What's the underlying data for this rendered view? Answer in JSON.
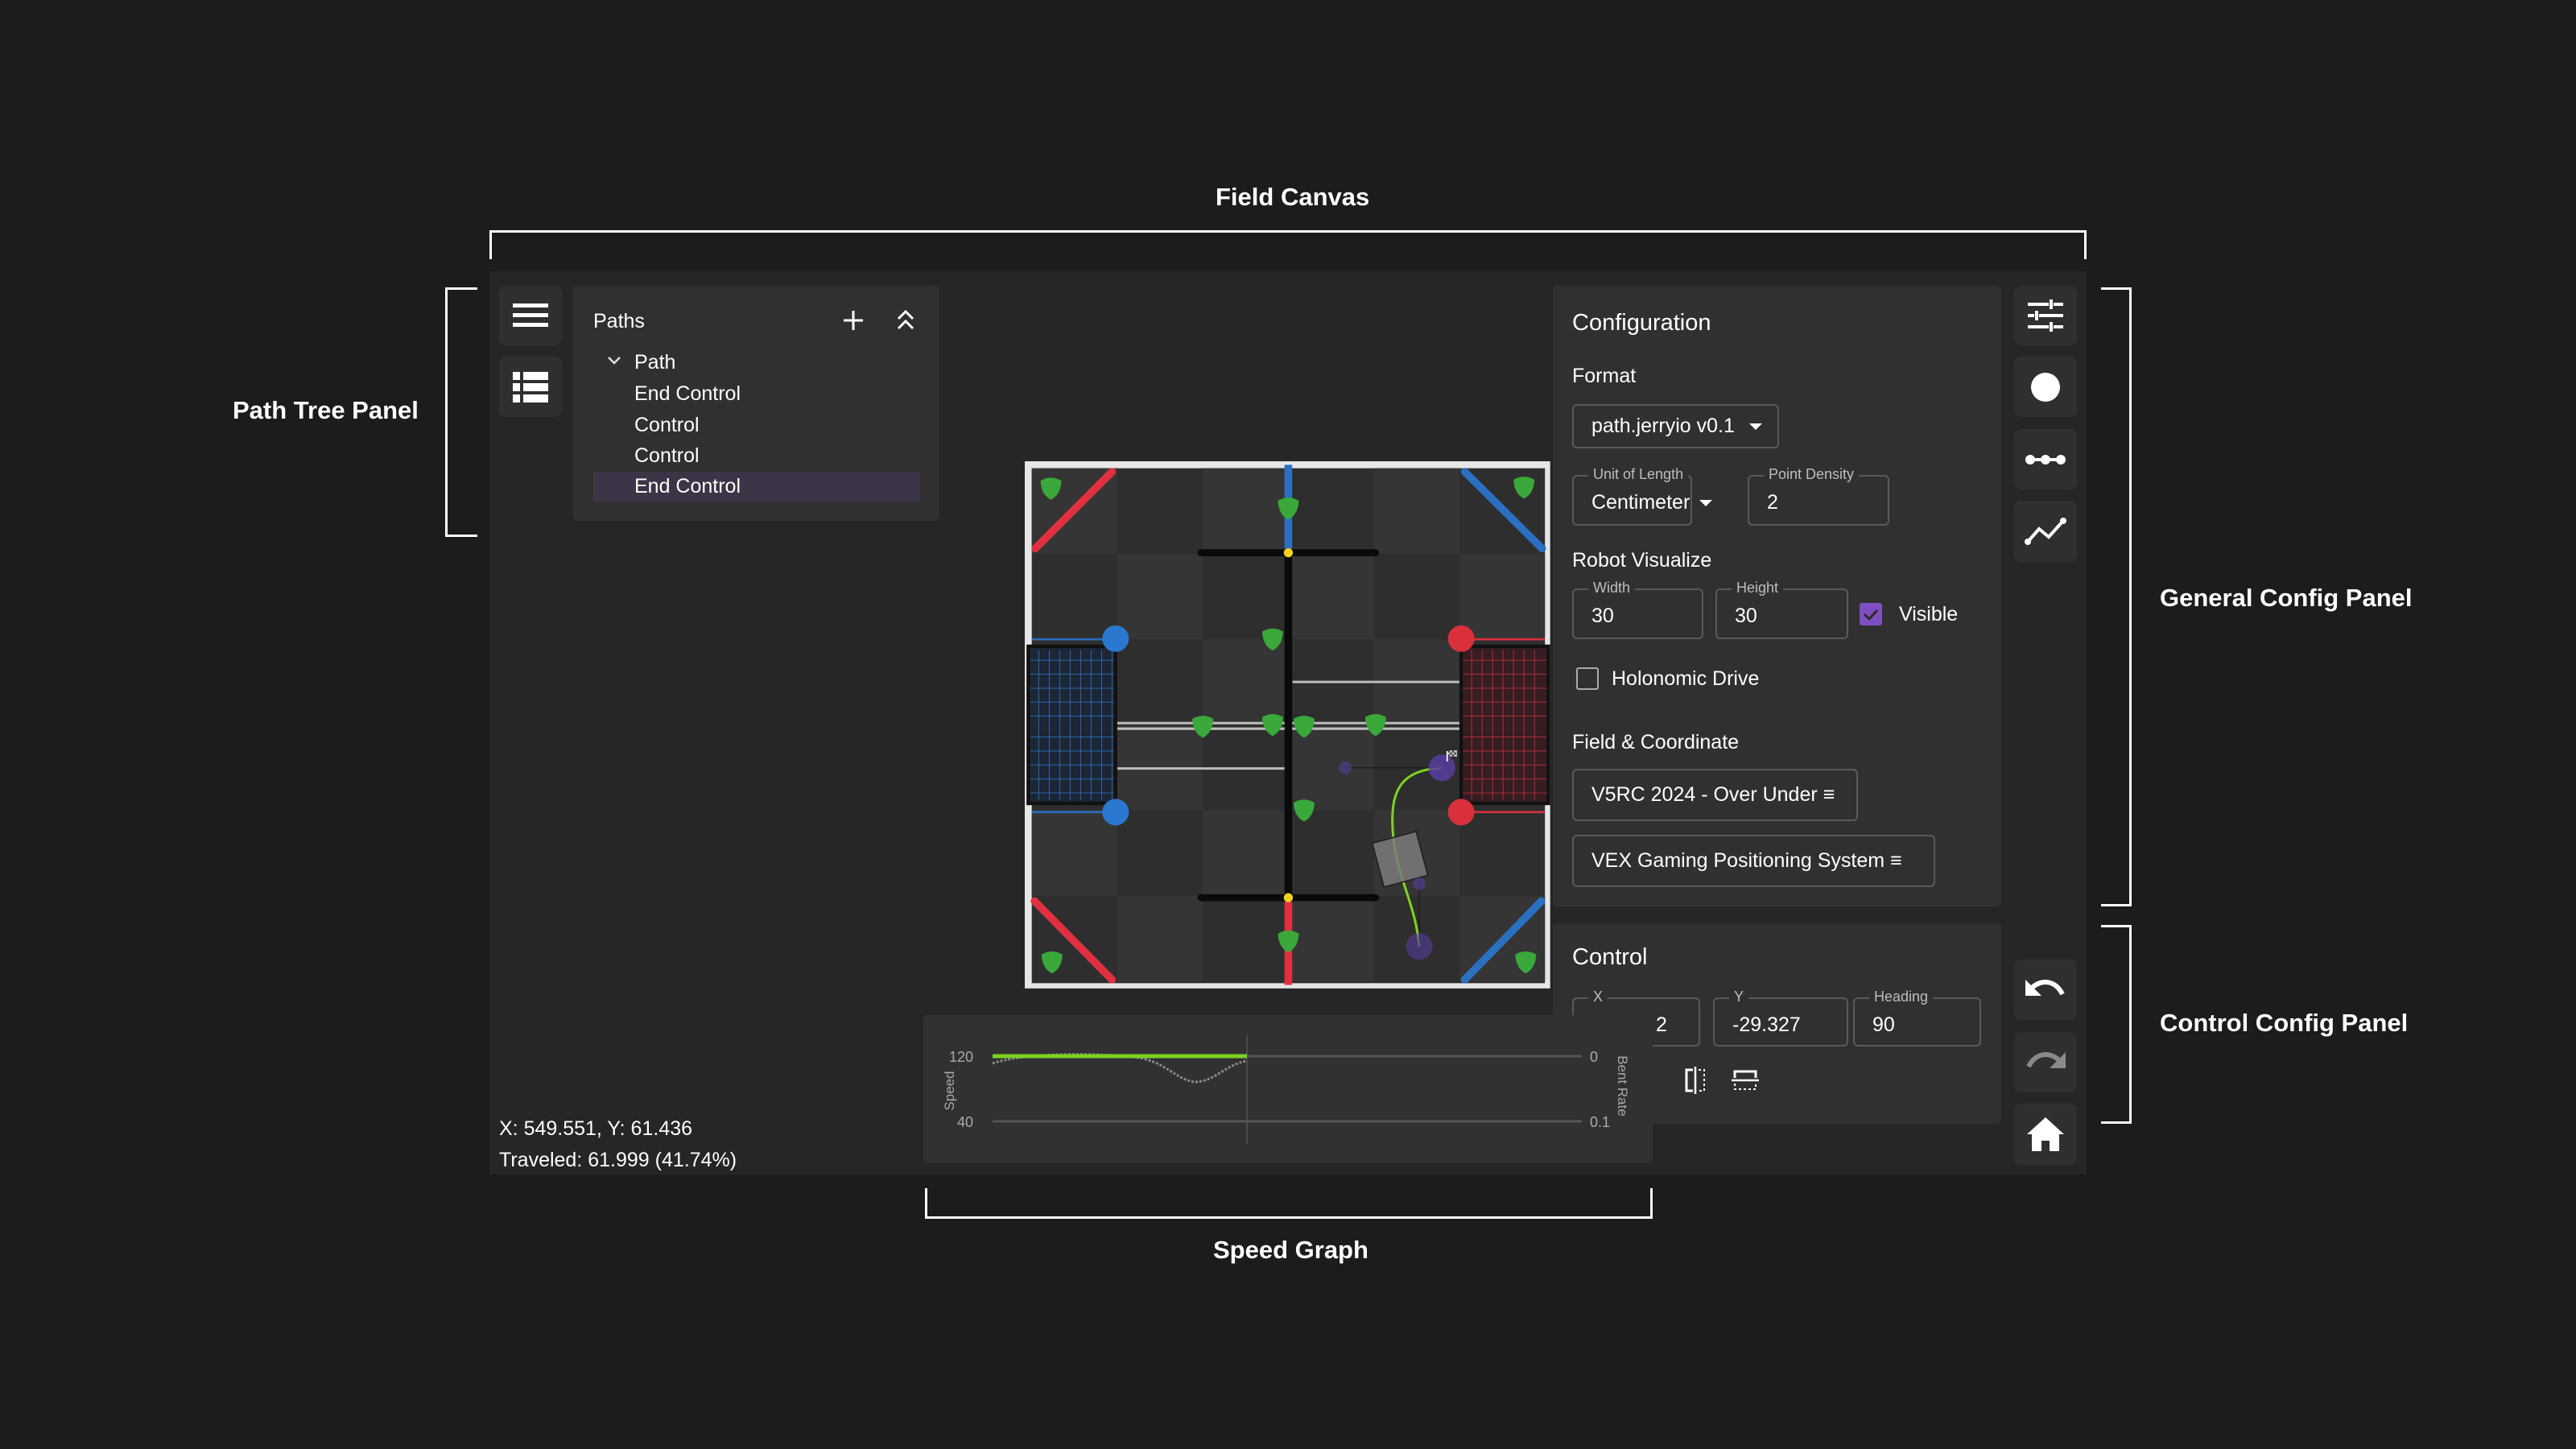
{
  "annotations": {
    "field_canvas": "Field Canvas",
    "path_tree_panel": "Path Tree Panel",
    "general_config_panel": "General Config Panel",
    "control_config_panel": "Control Config Panel",
    "speed_graph": "Speed Graph"
  },
  "left_toolbar": {
    "items": [
      {
        "icon": "menu-icon"
      },
      {
        "icon": "list-icon"
      }
    ]
  },
  "paths_panel": {
    "title": "Paths",
    "add_icon": "plus-icon",
    "collapse_icon": "double-chevron-up-icon",
    "tree": {
      "path_name": "Path",
      "expanded": true,
      "items": [
        {
          "label": "End Control",
          "selected": false
        },
        {
          "label": "Control",
          "selected": false
        },
        {
          "label": "Control",
          "selected": false
        },
        {
          "label": "End Control",
          "selected": true
        }
      ]
    }
  },
  "status": {
    "cursor": "X: 549.551, Y: 61.436",
    "traveled": "Traveled: 61.999 (41.74%)"
  },
  "configuration": {
    "title": "Configuration",
    "format_label": "Format",
    "format_value": "path.jerryio v0.1",
    "unit_label": "Unit of Length",
    "unit_value": "Centimeter",
    "density_label": "Point Density",
    "density_value": "2",
    "robot_title": "Robot Visualize",
    "width_label": "Width",
    "width_value": "30",
    "height_label": "Height",
    "height_value": "30",
    "visible_label": "Visible",
    "visible_checked": true,
    "holonomic_label": "Holonomic Drive",
    "holonomic_checked": false,
    "field_title": "Field & Coordinate",
    "field_value": "V5RC 2024 - Over Under ≡",
    "coord_value": "VEX Gaming Positioning System ≡"
  },
  "control": {
    "title": "Control",
    "x_label": "X",
    "x_value": "2",
    "y_label": "Y",
    "y_value": "-29.327",
    "heading_label": "Heading",
    "heading_value": "90",
    "flip_horizontal_icon": "flip-horizontal-icon",
    "flip_vertical_icon": "flip-vertical-icon"
  },
  "right_toolbar": {
    "items": [
      {
        "icon": "sliders-icon"
      },
      {
        "icon": "circle-icon"
      },
      {
        "icon": "dotted-line-icon"
      },
      {
        "icon": "line-chart-icon"
      }
    ],
    "undo_icon": "undo-icon",
    "redo_icon": "redo-icon",
    "home_icon": "home-icon"
  },
  "speed_graph": {
    "left_axis_label": "Speed",
    "right_axis_label": "Bent Rate",
    "left_ticks": [
      "120",
      "40"
    ],
    "right_ticks": [
      "0",
      "0.1"
    ],
    "speed_color": "#7cd321",
    "bent_rate_color": "#8a8a8a"
  },
  "colors": {
    "accent": "#7e4fc0",
    "selected_row": "#3d3447",
    "path": "#7cd321",
    "control_point": "#5b3ea8"
  }
}
